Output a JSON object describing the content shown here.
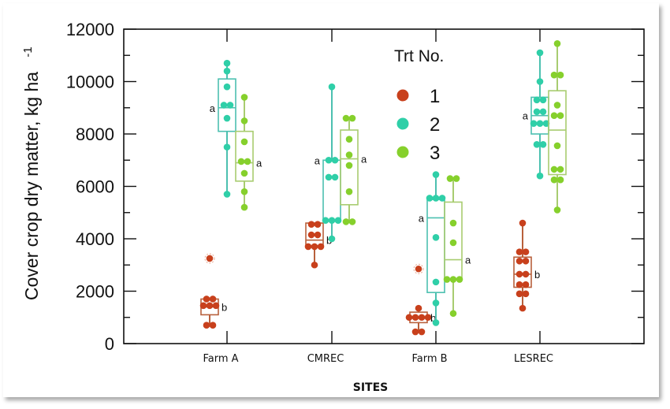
{
  "chart_data": {
    "type": "box",
    "title": "",
    "xlabel": "SITES",
    "ylabel": "Cover crop dry matter, kg ha",
    "ylabel_superscript": "-1",
    "ylim": [
      0,
      12000
    ],
    "yticks": [
      0,
      2000,
      4000,
      6000,
      8000,
      10000,
      12000
    ],
    "ytick_labels": [
      "0",
      "2000",
      "4000",
      "6000",
      "8000",
      "10000",
      "12000"
    ],
    "categories": [
      "Farm A",
      "CMREC",
      "Farm B",
      "LESREC"
    ],
    "legend": {
      "title": "Trt No.",
      "placement": "top-center",
      "entries": [
        {
          "label": "1",
          "color": "#c8401c"
        },
        {
          "label": "2",
          "color": "#2fcfa8"
        },
        {
          "label": "3",
          "color": "#86d02c"
        }
      ]
    },
    "series": [
      {
        "name": "1",
        "color": "#c8401c",
        "box_color": "#b8603c",
        "boxes": [
          {
            "category": "Farm A",
            "q1": 1100,
            "median": 1400,
            "q3": 1700,
            "whisker_low": 700,
            "whisker_high": 1700,
            "letter": "b",
            "points": [
              1700,
              1700,
              1450,
              1450,
              1450,
              700,
              700
            ],
            "outliers": [
              3250
            ]
          },
          {
            "category": "CMREC",
            "q1": 3700,
            "median": 3950,
            "q3": 4600,
            "whisker_low": 3000,
            "whisker_high": 4600,
            "letter": "b",
            "points": [
              4550,
              4550,
              4150,
              4150,
              3700,
              3700,
              3700,
              3000
            ],
            "outliers": []
          },
          {
            "category": "Farm B",
            "q1": 800,
            "median": 1000,
            "q3": 1200,
            "whisker_low": 450,
            "whisker_high": 1350,
            "letter": "b",
            "points": [
              1350,
              1000,
              1000,
              1000,
              1000,
              450,
              450
            ],
            "outliers": [
              2850
            ]
          },
          {
            "category": "LESREC",
            "q1": 2150,
            "median": 2650,
            "q3": 3300,
            "whisker_low": 1350,
            "whisker_high": 4600,
            "letter": "b",
            "points": [
              4600,
              3500,
              3500,
              3150,
              3150,
              2650,
              2650,
              2250,
              2250,
              1900,
              1900,
              1350
            ],
            "outliers": []
          }
        ]
      },
      {
        "name": "2",
        "color": "#2fcfa8",
        "box_color": "#4cc0b0",
        "boxes": [
          {
            "category": "Farm A",
            "q1": 8100,
            "median": 9000,
            "q3": 10100,
            "whisker_low": 5700,
            "whisker_high": 10700,
            "letter": "a",
            "points": [
              10700,
              10400,
              9800,
              9100,
              9100,
              8600,
              7500,
              5700
            ],
            "outliers": []
          },
          {
            "category": "CMREC",
            "q1": 4700,
            "median": 7000,
            "q3": 7000,
            "whisker_low": 4000,
            "whisker_high": 9800,
            "letter": "a",
            "points": [
              9800,
              7000,
              7000,
              6350,
              6350,
              4700,
              4700,
              4700,
              4000
            ],
            "outliers": []
          },
          {
            "category": "Farm B",
            "q1": 1950,
            "median": 4800,
            "q3": 5500,
            "whisker_low": 800,
            "whisker_high": 6450,
            "letter": "a",
            "points": [
              6450,
              5550,
              5550,
              5550,
              4050,
              2350,
              1550,
              800
            ],
            "outliers": []
          },
          {
            "category": "LESREC",
            "q1": 8000,
            "median": 8700,
            "q3": 9400,
            "whisker_low": 6400,
            "whisker_high": 11100,
            "letter": "a",
            "points": [
              11100,
              10000,
              9300,
              9300,
              8850,
              8850,
              8400,
              8400,
              8400,
              7600,
              7600,
              6400
            ],
            "outliers": []
          }
        ]
      },
      {
        "name": "3",
        "color": "#86d02c",
        "box_color": "#a8cc70",
        "boxes": [
          {
            "category": "Farm A",
            "q1": 6200,
            "median": 6900,
            "q3": 8100,
            "whisker_low": 5200,
            "whisker_high": 9400,
            "letter": "a",
            "points": [
              9400,
              8500,
              7700,
              6950,
              6950,
              6500,
              5800,
              5200
            ],
            "outliers": []
          },
          {
            "category": "CMREC",
            "q1": 5300,
            "median": 7050,
            "q3": 8150,
            "whisker_low": 4650,
            "whisker_high": 8600,
            "letter": "a",
            "points": [
              8600,
              8600,
              7800,
              7200,
              6800,
              5800,
              4650,
              4650
            ],
            "outliers": []
          },
          {
            "category": "Farm B",
            "q1": 2450,
            "median": 3200,
            "q3": 5400,
            "whisker_low": 1150,
            "whisker_high": 6300,
            "letter": "a",
            "points": [
              6300,
              6300,
              4600,
              3850,
              2450,
              2450,
              2450,
              1150
            ],
            "outliers": []
          },
          {
            "category": "LESREC",
            "q1": 6450,
            "median": 8150,
            "q3": 9650,
            "whisker_low": 5100,
            "whisker_high": 11450,
            "letter": "",
            "points": [
              11450,
              10250,
              10250,
              9100,
              8700,
              8700,
              7550,
              6650,
              6650,
              6250,
              6250,
              5100
            ],
            "outliers": []
          }
        ]
      }
    ],
    "grid": false
  }
}
